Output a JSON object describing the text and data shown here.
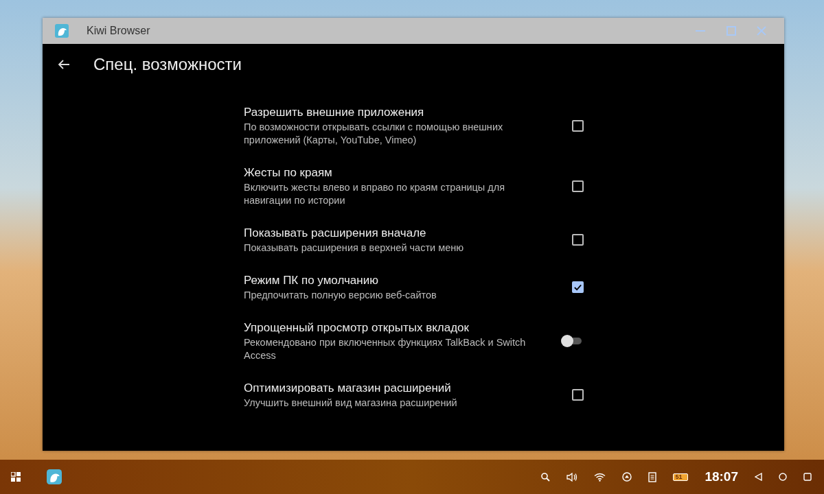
{
  "window": {
    "title": "Kiwi Browser"
  },
  "page": {
    "title": "Спец. возможности"
  },
  "settings": [
    {
      "kind": "checkbox",
      "title": "Разрешить внешние приложения",
      "subtitle": "По возможности открывать ссылки с помощью внешних приложений (Карты, YouTube, Vimeo)",
      "checked": false
    },
    {
      "kind": "checkbox",
      "title": "Жесты по краям",
      "subtitle": "Включить жесты влево и вправо по краям страницы для навигации по истории",
      "checked": false
    },
    {
      "kind": "checkbox",
      "title": "Показывать расширения вначале",
      "subtitle": "Показывать расширения в верхней части меню",
      "checked": false
    },
    {
      "kind": "checkbox",
      "title": "Режим ПК по умолчанию",
      "subtitle": "Предпочитать полную версию веб-сайтов",
      "checked": true
    },
    {
      "kind": "switch",
      "title": "Упрощенный просмотр открытых вкладок",
      "subtitle": "Рекомендовано при включенных функциях TalkBack и Switch Access",
      "checked": false
    },
    {
      "kind": "checkbox",
      "title": "Оптимизировать магазин расширений",
      "subtitle": "Улучшить внешний вид магазина расширений",
      "checked": false
    }
  ],
  "taskbar": {
    "battery": "51",
    "time": "18:07"
  }
}
